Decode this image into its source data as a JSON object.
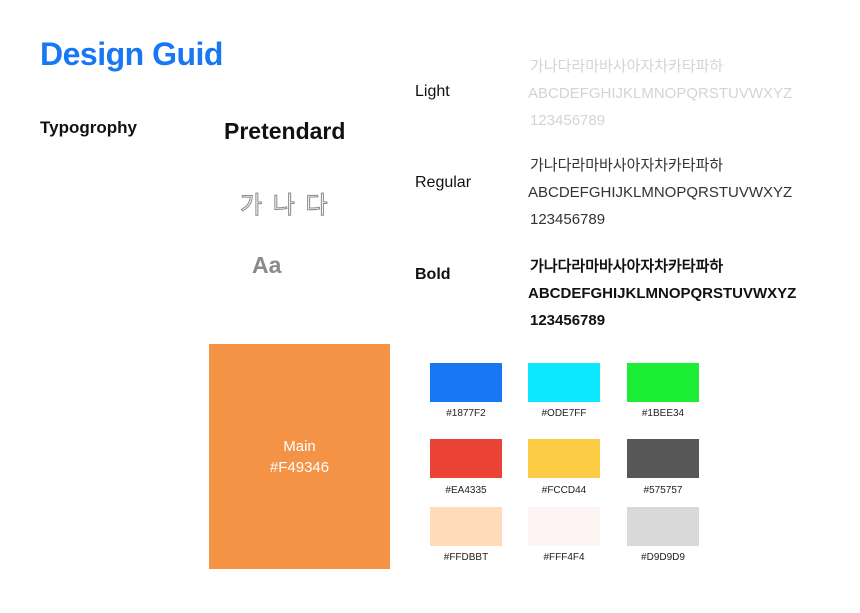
{
  "title": "Design Guid",
  "typography": {
    "section_label": "Typogrophy",
    "font_name": "Pretendard",
    "sample_korean": "가 나 다",
    "sample_latin": "Aa",
    "weights": [
      {
        "label": "Light",
        "korean": "가나다라마바사아자차카타파하",
        "latin": "ABCDEFGHIJKLMNOPQRSTUVWXYZ",
        "digits": "123456789"
      },
      {
        "label": "Regular",
        "korean": "가나다라마바사아자차카타파하",
        "latin": "ABCDEFGHIJKLMNOPQRSTUVWXYZ",
        "digits": "123456789"
      },
      {
        "label": "Bold",
        "korean": "가나다라마바사아자차카타파하",
        "latin": "ABCDEFGHIJKLMNOPQRSTUVWXYZ",
        "digits": "123456789"
      }
    ]
  },
  "colors": {
    "main": {
      "label": "Main",
      "code": "#F49346",
      "hex": "#F49346"
    },
    "swatches": [
      {
        "code": "#1877F2",
        "hex": "#1877F2"
      },
      {
        "code": "#ODE7FF",
        "hex": "#0DE7FF"
      },
      {
        "code": "#1BEE34",
        "hex": "#1BEE34"
      },
      {
        "code": "#EA4335",
        "hex": "#EA4335"
      },
      {
        "code": "#FCCD44",
        "hex": "#FCCD44"
      },
      {
        "code": "#575757",
        "hex": "#575757"
      },
      {
        "code": "#FFDBBT",
        "hex": "#FFDBBB"
      },
      {
        "code": "#FFF4F4",
        "hex": "#FFF4F4"
      },
      {
        "code": "#D9D9D9",
        "hex": "#D9D9D9"
      }
    ]
  },
  "accent": "#1877F2"
}
